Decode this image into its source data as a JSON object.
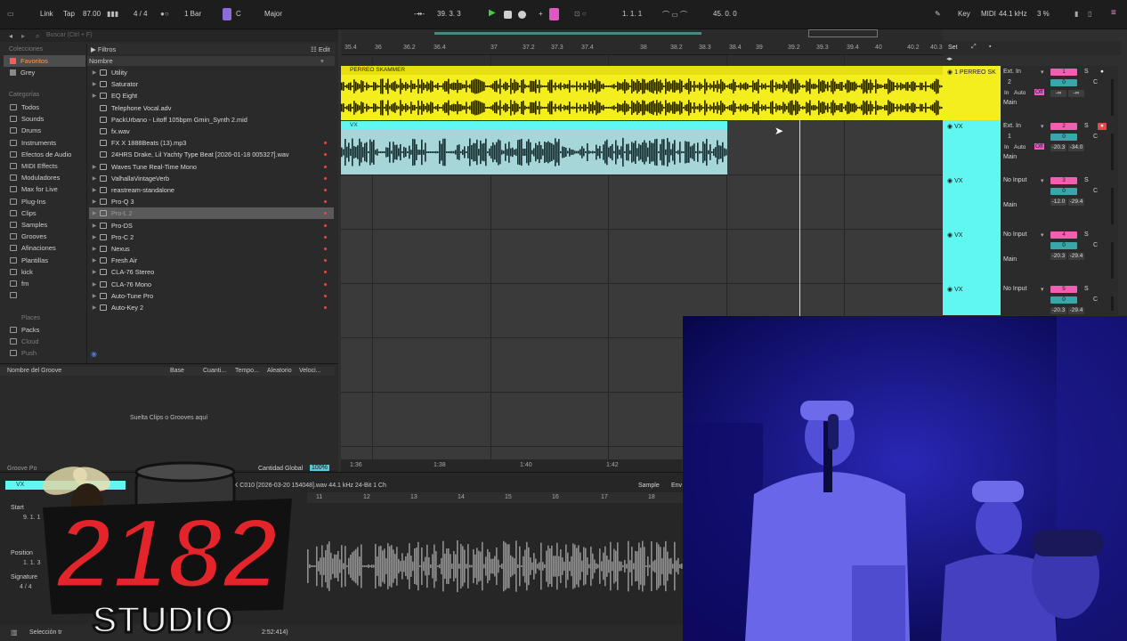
{
  "transport": {
    "link": "Link",
    "tap": "Tap",
    "tempo": "87.00",
    "time_sig": "4 / 4",
    "quant": "1 Bar",
    "key": "C",
    "scale": "Major",
    "position": "39.  3.  3",
    "loop_start": "1.   1.   1",
    "loop_len": "45.   0.   0",
    "key_label": "Key",
    "midi_label": "MIDI",
    "sample_rate": "44.1 kHz",
    "cpu": "3 %"
  },
  "browser": {
    "search_placeholder": "Buscar (Ctrl + F)",
    "collections_label": "Colecciones",
    "collections": [
      "Favoritos",
      "Grey"
    ],
    "categories_label": "Categorías",
    "categories": [
      "Todos",
      "Sounds",
      "Drums",
      "Instruments",
      "Efectos de Audio",
      "MIDI Effects",
      "Moduladores",
      "Max for Live",
      "Plug-Ins",
      "Clips",
      "Samples",
      "Grooves",
      "Afinaciones",
      "Plantillas",
      "kick",
      "fm",
      ""
    ],
    "places_label": "Places",
    "places": [
      "Packs",
      "Cloud",
      "Push"
    ],
    "filters_label": "Filtros",
    "edit_label": "Edit",
    "name_header": "Nombre",
    "files": [
      "Utility",
      "Saturator",
      "EQ Eight",
      "Telephone Vocal.adv",
      "PackUrbano - Litoff 105bpm Gmin_Synth 2.mid",
      "fx.wav",
      "FX X 1888Beats (13).mp3",
      "24HRS Drake, Lil Yachty Type Beat [2026-01-18 005327].wav",
      "Waves Tune Real-Time Mono",
      "ValhallaVintageVerb",
      "reastream-standalone",
      "Pro-Q 3",
      "Pro-L 2",
      "Pro-DS",
      "Pro-C 2",
      "Nexus",
      "Fresh Air",
      "CLA-76 Stereo",
      "CLA-76 Mono",
      "Auto-Tune Pro",
      "Auto-Key 2"
    ]
  },
  "groove": {
    "headers": [
      "Nombre del Groove",
      "Base",
      "Cuanti...",
      "Tempo...",
      "Aleatorio",
      "Veloci..."
    ],
    "drop_text": "Suelta Clips o Grooves aquí",
    "global_label": "Cantidad Global",
    "global_value": "100%",
    "pool_label": "Groove Po"
  },
  "ruler": {
    "ticks": [
      "35.4",
      "36",
      "36.2",
      "36.4",
      "37",
      "37.2",
      "37.3",
      "37.4",
      "38",
      "38.2",
      "38.3",
      "38.4",
      "39",
      "39.2",
      "39.3",
      "39.4",
      "40",
      "40.2",
      "40.3"
    ],
    "time": [
      "1:36",
      "1:38",
      "1:40",
      "1:42"
    ],
    "set_label": "Set"
  },
  "tracks": [
    {
      "clip": "PERREO SKAMMER",
      "name": "1 PERREO SK",
      "input": "Ext. In",
      "channel": "2",
      "out": "Main",
      "num": "1",
      "vol": "0",
      "pan": "C",
      "db1": "-∞",
      "db2": "-∞",
      "monitor": [
        "In",
        "Auto",
        "Off"
      ]
    },
    {
      "clip": "VX",
      "name": "VX",
      "input": "Ext. In",
      "channel": "1",
      "out": "Main",
      "num": "2",
      "vol": "0",
      "pan": "C",
      "db1": "-20.3",
      "db2": "-34.0",
      "monitor": [
        "In",
        "Auto",
        "Off"
      ]
    },
    {
      "clip": "",
      "name": "VX",
      "input": "No Input",
      "channel": "",
      "out": "Main",
      "num": "3",
      "vol": "0",
      "pan": "C",
      "db1": "-12.0",
      "db2": "-29.4",
      "monitor": []
    },
    {
      "clip": "",
      "name": "VX",
      "input": "No Input",
      "channel": "",
      "out": "Main",
      "num": "4",
      "vol": "0",
      "pan": "C",
      "db1": "-20.3",
      "db2": "-29.4",
      "monitor": []
    },
    {
      "clip": "",
      "name": "VX",
      "input": "No Input",
      "channel": "",
      "out": "",
      "num": "5",
      "vol": "0",
      "pan": "C",
      "db1": "-20.3",
      "db2": "-29.4",
      "monitor": []
    }
  ],
  "detail": {
    "clip_name": "VX",
    "file_info": "VX C010 [2026-03-20 154048].wav  44.1 kHz  24-Bit  1 Ch",
    "sample_label": "Sample",
    "env_label": "Env",
    "start_label": "Start",
    "start_val": "9.  1.  1",
    "position_label": "Position",
    "position_val": "1.  1.  3",
    "signature_label": "Signature",
    "signature_val": "4  /  4",
    "ticks": [
      "11",
      "12",
      "13",
      "14",
      "15",
      "16",
      "17",
      "18"
    ],
    "status": "Selección tr",
    "status_right": "2:52:414)"
  },
  "logo": {
    "main": "2182",
    "sub": "STUDIO"
  },
  "colors": {
    "yellow": "#f5ee1f",
    "cyan": "#5ff7ef",
    "accent": "#f25fb0",
    "orange": "#ff9a4f"
  }
}
